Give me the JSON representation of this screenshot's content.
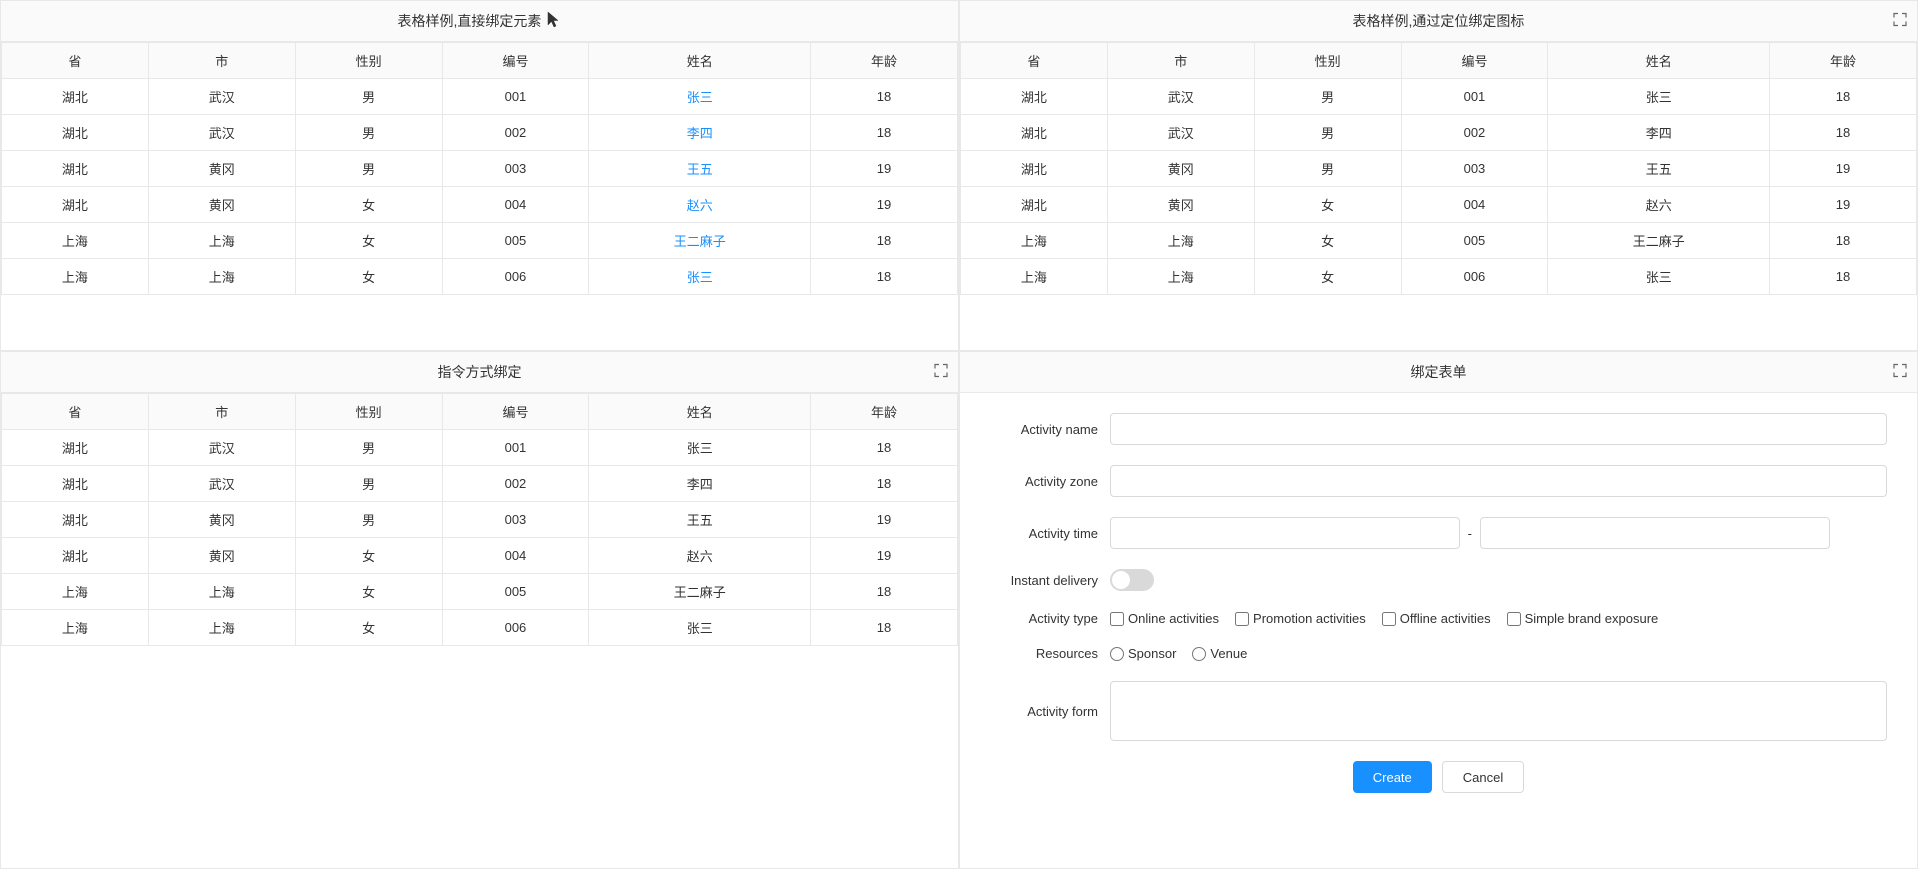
{
  "panels": {
    "topLeft": {
      "title": "表格样例,直接绑定元素",
      "columns": [
        "省",
        "市",
        "性别",
        "编号",
        "姓名",
        "年龄"
      ],
      "rows": [
        [
          "湖北",
          "武汉",
          "男",
          "001",
          "张三",
          "18"
        ],
        [
          "湖北",
          "武汉",
          "男",
          "002",
          "李四",
          "18"
        ],
        [
          "湖北",
          "黄冈",
          "男",
          "003",
          "王五",
          "19"
        ],
        [
          "湖北",
          "黄冈",
          "女",
          "004",
          "赵六",
          "19"
        ],
        [
          "上海",
          "上海",
          "女",
          "005",
          "王二麻子",
          "18"
        ],
        [
          "上海",
          "上海",
          "女",
          "006",
          "张三",
          "18"
        ]
      ],
      "linkCol": 4
    },
    "topRight": {
      "title": "表格样例,通过定位绑定图标",
      "columns": [
        "省",
        "市",
        "性别",
        "编号",
        "姓名",
        "年龄"
      ],
      "rows": [
        [
          "湖北",
          "武汉",
          "男",
          "001",
          "张三",
          "18"
        ],
        [
          "湖北",
          "武汉",
          "男",
          "002",
          "李四",
          "18"
        ],
        [
          "湖北",
          "黄冈",
          "男",
          "003",
          "王五",
          "19"
        ],
        [
          "湖北",
          "黄冈",
          "女",
          "004",
          "赵六",
          "19"
        ],
        [
          "上海",
          "上海",
          "女",
          "005",
          "王二麻子",
          "18"
        ],
        [
          "上海",
          "上海",
          "女",
          "006",
          "张三",
          "18"
        ]
      ],
      "hasExpandIcon": true
    },
    "bottomLeft": {
      "title": "指令方式绑定",
      "columns": [
        "省",
        "市",
        "性别",
        "编号",
        "姓名",
        "年龄"
      ],
      "rows": [
        [
          "湖北",
          "武汉",
          "男",
          "001",
          "张三",
          "18"
        ],
        [
          "湖北",
          "武汉",
          "男",
          "002",
          "李四",
          "18"
        ],
        [
          "湖北",
          "黄冈",
          "男",
          "003",
          "王五",
          "19"
        ],
        [
          "湖北",
          "黄冈",
          "女",
          "004",
          "赵六",
          "19"
        ],
        [
          "上海",
          "上海",
          "女",
          "005",
          "王二麻子",
          "18"
        ],
        [
          "上海",
          "上海",
          "女",
          "006",
          "张三",
          "18"
        ]
      ],
      "hasExpandIcon": true
    },
    "bottomRight": {
      "title": "绑定表单",
      "hasExpandIcon": true,
      "form": {
        "fields": [
          {
            "label": "Activity name",
            "type": "input",
            "value": "",
            "placeholder": ""
          },
          {
            "label": "Activity zone",
            "type": "input",
            "value": "",
            "placeholder": ""
          },
          {
            "label": "Activity time",
            "type": "daterange",
            "separator": "-"
          },
          {
            "label": "Instant delivery",
            "type": "switch"
          },
          {
            "label": "Activity type",
            "type": "checkbox",
            "options": [
              "Online activities",
              "Promotion activities",
              "Offline activities",
              "Simple brand exposure"
            ]
          },
          {
            "label": "Resources",
            "type": "radio",
            "options": [
              "Sponsor",
              "Venue"
            ]
          },
          {
            "label": "Activity form",
            "type": "textarea",
            "value": "",
            "placeholder": ""
          }
        ],
        "buttons": {
          "create": "Create",
          "cancel": "Cancel"
        }
      }
    }
  }
}
